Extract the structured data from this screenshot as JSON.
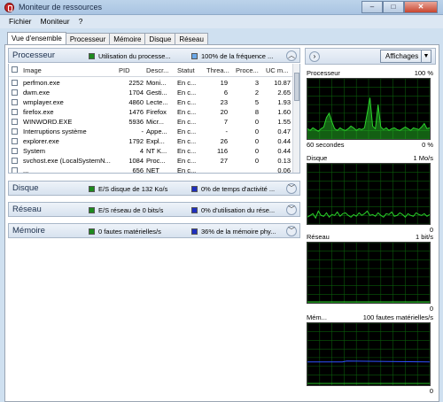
{
  "window": {
    "title": "Moniteur de ressources",
    "controls": {
      "minimize": "–",
      "maximize": "□",
      "close": "✕"
    }
  },
  "menu": [
    "Fichier",
    "Moniteur",
    "?"
  ],
  "tabs": [
    "Vue d'ensemble",
    "Processeur",
    "Mémoire",
    "Disque",
    "Réseau"
  ],
  "cpu": {
    "title": "Processeur",
    "stat1": "Utilisation du processe...",
    "stat2": "100% de la fréquence ...",
    "columns": [
      "Image",
      "PID",
      "Descr...",
      "Statut",
      "Threa...",
      "Proce...",
      "UC m..."
    ],
    "rows": [
      [
        "perfmon.exe",
        "2252",
        "Moni...",
        "En c...",
        "19",
        "3",
        "10.87"
      ],
      [
        "dwm.exe",
        "1704",
        "Gesti...",
        "En c...",
        "6",
        "2",
        "2.65"
      ],
      [
        "wmplayer.exe",
        "4860",
        "Lecte...",
        "En c...",
        "23",
        "5",
        "1.93"
      ],
      [
        "firefox.exe",
        "1476",
        "Firefox",
        "En c...",
        "20",
        "8",
        "1.60"
      ],
      [
        "WINWORD.EXE",
        "5936",
        "Micr...",
        "En c...",
        "7",
        "0",
        "1.55"
      ],
      [
        "Interruptions système",
        "-",
        "Appe...",
        "En c...",
        "-",
        "0",
        "0.47"
      ],
      [
        "explorer.exe",
        "1792",
        "Expl...",
        "En c...",
        "26",
        "0",
        "0.44"
      ],
      [
        "System",
        "4",
        "NT K...",
        "En c...",
        "116",
        "0",
        "0.44"
      ],
      [
        "svchost.exe (LocalSystemN...",
        "1084",
        "Proc...",
        "En c...",
        "27",
        "0",
        "0.13"
      ],
      [
        "...",
        "656",
        "NET",
        "En c...",
        "",
        "",
        "0.06"
      ]
    ]
  },
  "disk": {
    "title": "Disque",
    "stat1": "E/S disque de 132 Ko/s",
    "stat2": "0% de temps d'activité ..."
  },
  "network": {
    "title": "Réseau",
    "stat1": "E/S réseau de 0 bits/s",
    "stat2": "0% d'utilisation du rése..."
  },
  "memory": {
    "title": "Mémoire",
    "stat1": "0 fautes matérielles/s",
    "stat2": "36% de la mémoire phy..."
  },
  "right": {
    "views_label": "Affichages",
    "expand_glyph": "›",
    "graphs": [
      {
        "label": "Processeur",
        "max": "100 %",
        "foot_left": "60 secondes",
        "foot_right": "0 %",
        "color": "#2bd32b"
      },
      {
        "label": "Disque",
        "max": "1 Mo/s",
        "foot_left": "",
        "foot_right": "0",
        "color": "#2bd32b"
      },
      {
        "label": "Réseau",
        "max": "1 bit/s",
        "foot_left": "",
        "foot_right": "0",
        "color": "#2bd32b"
      },
      {
        "label": "Mém...",
        "max": "100 fautes matérielles/s",
        "foot_left": "",
        "foot_right": "0",
        "color": "#3050ff"
      }
    ]
  },
  "colors": {
    "green": "#1d8a1d",
    "blue": "#1f2fbf",
    "lightblue": "#6aa8e8"
  }
}
